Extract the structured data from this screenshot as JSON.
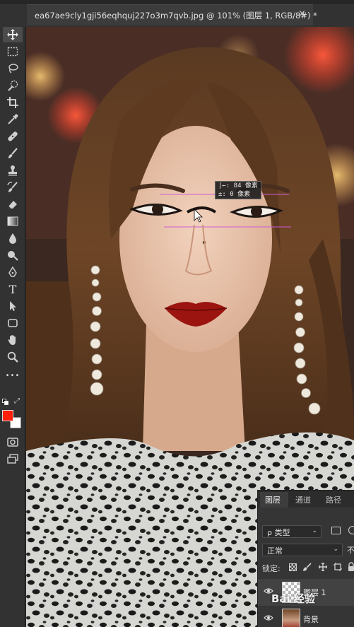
{
  "document_tab": {
    "title": "ea67ae9cly1gji56eqhquj227o3m7qvb.jpg @ 101% (图层 1, RGB/8#) *",
    "close": "×"
  },
  "toolbar": {
    "tools": [
      {
        "name": "move-tool",
        "active": true
      },
      {
        "name": "marquee-tool"
      },
      {
        "name": "lasso-tool"
      },
      {
        "name": "quick-select-tool"
      },
      {
        "name": "crop-tool"
      },
      {
        "name": "eyedropper-tool"
      },
      {
        "name": "healing-brush-tool"
      },
      {
        "name": "brush-tool"
      },
      {
        "name": "clone-stamp-tool"
      },
      {
        "name": "history-brush-tool"
      },
      {
        "name": "eraser-tool"
      },
      {
        "name": "gradient-tool"
      },
      {
        "name": "blur-tool"
      },
      {
        "name": "dodge-tool"
      },
      {
        "name": "pen-tool"
      },
      {
        "name": "type-tool",
        "label": "T"
      },
      {
        "name": "path-select-tool"
      },
      {
        "name": "shape-tool"
      },
      {
        "name": "hand-tool"
      },
      {
        "name": "zoom-tool"
      },
      {
        "name": "more-tools",
        "label": "•••"
      }
    ],
    "foreground_color": "#ff1e0a",
    "background_color": "#ffffff"
  },
  "canvas": {
    "measure_tooltip": {
      "line1": "|←: 84 像素",
      "line2": "±:  0 像素"
    },
    "guide_color": "#d25ad2"
  },
  "layers_panel": {
    "tabs": [
      "图层",
      "通道",
      "路径"
    ],
    "filter_label": "ρ 类型",
    "blend_mode": "正常",
    "opacity_label": "不",
    "lock_label": "锁定:",
    "layers": [
      {
        "name": "图层 1",
        "selected": true
      },
      {
        "name": "背景",
        "selected": false
      }
    ]
  },
  "watermark": "Bai 经验"
}
